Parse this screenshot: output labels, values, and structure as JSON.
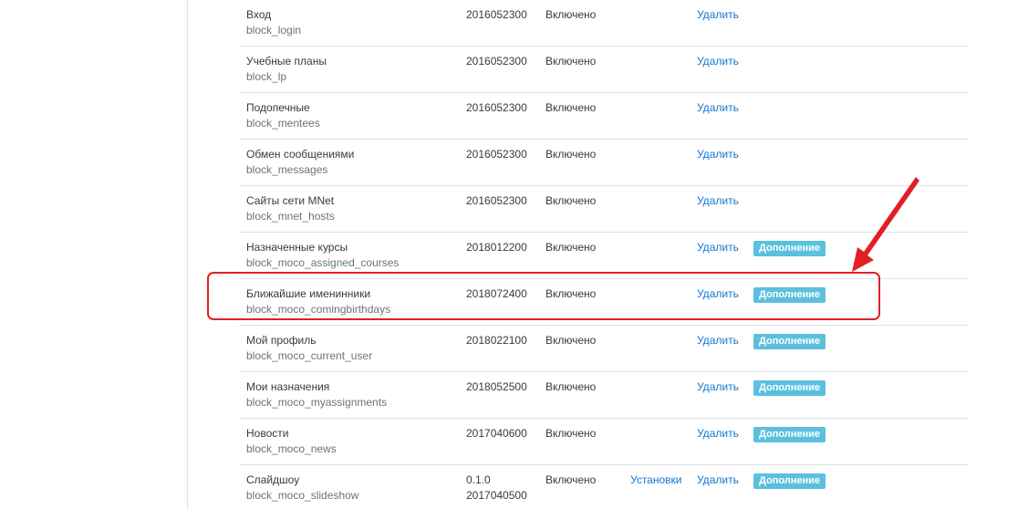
{
  "plugins": {
    "rows": [
      {
        "name": "Вход",
        "code": "block_login",
        "version": [
          "2016052300"
        ],
        "status": "Включено",
        "settings": "",
        "delete": "Удалить",
        "extra": ""
      },
      {
        "name": "Учебные планы",
        "code": "block_lp",
        "version": [
          "2016052300"
        ],
        "status": "Включено",
        "settings": "",
        "delete": "Удалить",
        "extra": ""
      },
      {
        "name": "Подопечные",
        "code": "block_mentees",
        "version": [
          "2016052300"
        ],
        "status": "Включено",
        "settings": "",
        "delete": "Удалить",
        "extra": ""
      },
      {
        "name": "Обмен сообщениями",
        "code": "block_messages",
        "version": [
          "2016052300"
        ],
        "status": "Включено",
        "settings": "",
        "delete": "Удалить",
        "extra": ""
      },
      {
        "name": "Сайты сети MNet",
        "code": "block_mnet_hosts",
        "version": [
          "2016052300"
        ],
        "status": "Включено",
        "settings": "",
        "delete": "Удалить",
        "extra": ""
      },
      {
        "name": "Назначенные курсы",
        "code": "block_moco_assigned_courses",
        "version": [
          "2018012200"
        ],
        "status": "Включено",
        "settings": "",
        "delete": "Удалить",
        "extra": "Дополнение"
      },
      {
        "name": "Ближайшие именинники",
        "code": "block_moco_comingbirthdays",
        "version": [
          "2018072400"
        ],
        "status": "Включено",
        "settings": "",
        "delete": "Удалить",
        "extra": "Дополнение"
      },
      {
        "name": "Мой профиль",
        "code": "block_moco_current_user",
        "version": [
          "2018022100"
        ],
        "status": "Включено",
        "settings": "",
        "delete": "Удалить",
        "extra": "Дополнение"
      },
      {
        "name": "Мои назначения",
        "code": "block_moco_myassignments",
        "version": [
          "2018052500"
        ],
        "status": "Включено",
        "settings": "",
        "delete": "Удалить",
        "extra": "Дополнение"
      },
      {
        "name": "Новости",
        "code": "block_moco_news",
        "version": [
          "2017040600"
        ],
        "status": "Включено",
        "settings": "",
        "delete": "Удалить",
        "extra": "Дополнение"
      },
      {
        "name": "Слайдшоу",
        "code": "block_moco_slideshow",
        "version": [
          "0.1.0",
          "2017040500"
        ],
        "status": "Включено",
        "settings": "Установки",
        "delete": "Удалить",
        "extra": "Дополнение"
      }
    ]
  },
  "annotation": {
    "highlight_color": "#e31e24",
    "highlighted_row": 6
  },
  "colors": {
    "link": "#1177d1",
    "badge": "#5bc0de",
    "border": "#dee2e6"
  }
}
